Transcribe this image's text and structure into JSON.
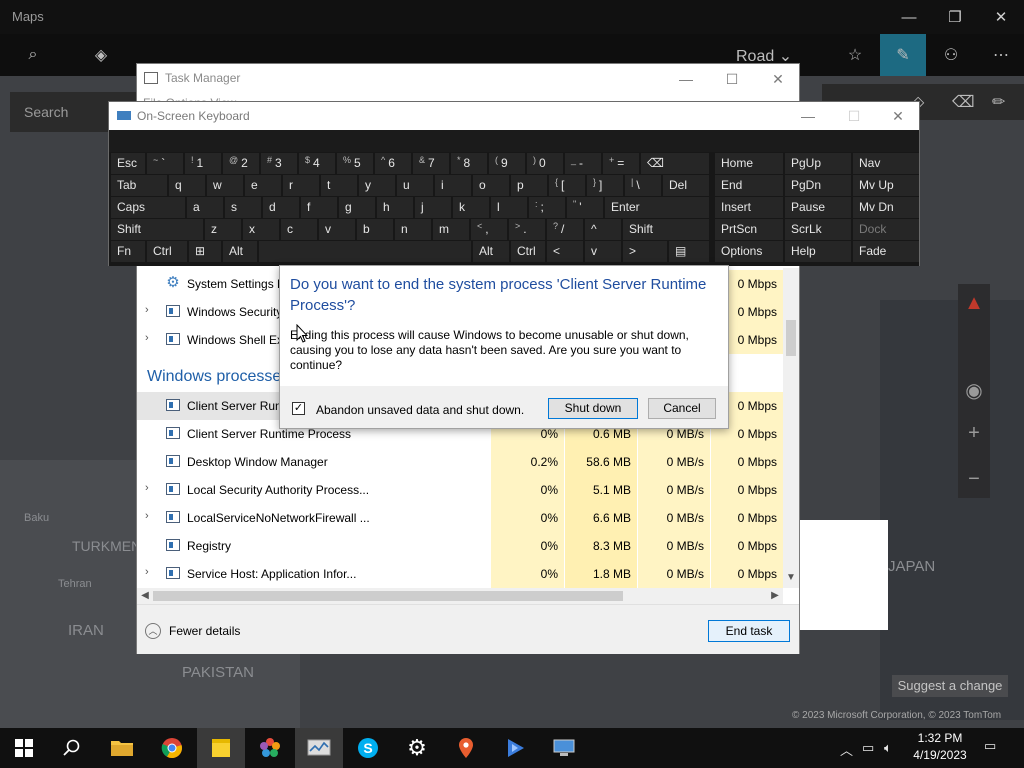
{
  "maps": {
    "title": "Maps",
    "search_placeholder": "Search",
    "road_label": "Road",
    "suggest_change": "Suggest a change",
    "copyright": "© 2023 Microsoft Corporation, © 2023 TomTom",
    "labels": {
      "baku": "Baku",
      "turkmen": "TURKMEN",
      "tehran": "Tehran",
      "iran": "IRAN",
      "pakistan": "PAKISTAN",
      "japan": "JAPAN"
    }
  },
  "task_manager": {
    "title": "Task Manager",
    "menu": "File  Options  View",
    "rows": [
      {
        "name": "System Settings B",
        "cpu": "",
        "mem": "",
        "disk": "",
        "net": "0 Mbps",
        "icon": "gear",
        "expand": false
      },
      {
        "name": "Windows Security",
        "cpu": "",
        "mem": "",
        "disk": "",
        "net": "0 Mbps",
        "icon": "window",
        "expand": true
      },
      {
        "name": "Windows Shell Ex",
        "cpu": "",
        "mem": "",
        "disk": "",
        "net": "0 Mbps",
        "icon": "window",
        "expand": true
      }
    ],
    "group_header": "Windows processes",
    "rows2": [
      {
        "name": "Client Server Runt",
        "cpu": "",
        "mem": "",
        "disk": "",
        "net": "0 Mbps",
        "expand": false
      },
      {
        "name": "Client Server Runtime Process",
        "cpu": "0%",
        "mem": "0.6 MB",
        "disk": "0 MB/s",
        "net": "0 Mbps",
        "expand": false
      },
      {
        "name": "Desktop Window Manager",
        "cpu": "0.2%",
        "mem": "58.6 MB",
        "disk": "0 MB/s",
        "net": "0 Mbps",
        "expand": false
      },
      {
        "name": "Local Security Authority Process...",
        "cpu": "0%",
        "mem": "5.1 MB",
        "disk": "0 MB/s",
        "net": "0 Mbps",
        "expand": true
      },
      {
        "name": "LocalServiceNoNetworkFirewall ...",
        "cpu": "0%",
        "mem": "6.6 MB",
        "disk": "0 MB/s",
        "net": "0 Mbps",
        "expand": true
      },
      {
        "name": "Registry",
        "cpu": "0%",
        "mem": "8.3 MB",
        "disk": "0 MB/s",
        "net": "0 Mbps",
        "expand": false
      },
      {
        "name": "Service Host: Application Infor...",
        "cpu": "0%",
        "mem": "1.8 MB",
        "disk": "0 MB/s",
        "net": "0 Mbps",
        "expand": true
      }
    ],
    "fewer_details": "Fewer details",
    "end_task": "End task"
  },
  "osk": {
    "title": "On-Screen Keyboard",
    "row1": [
      {
        "label": "Esc"
      },
      {
        "sub": "~",
        "label": "`"
      },
      {
        "sub": "!",
        "label": "1"
      },
      {
        "sub": "@",
        "label": "2"
      },
      {
        "sub": "#",
        "label": "3"
      },
      {
        "sub": "$",
        "label": "4"
      },
      {
        "sub": "%",
        "label": "5"
      },
      {
        "sub": "^",
        "label": "6"
      },
      {
        "sub": "&",
        "label": "7"
      },
      {
        "sub": "*",
        "label": "8"
      },
      {
        "sub": "(",
        "label": "9"
      },
      {
        "sub": ")",
        "label": "0"
      },
      {
        "sub": "_",
        "label": "-"
      },
      {
        "sub": "+",
        "label": "="
      },
      {
        "label": "⌫"
      }
    ],
    "row2": [
      {
        "label": "Tab"
      },
      {
        "label": "q"
      },
      {
        "label": "w"
      },
      {
        "label": "e"
      },
      {
        "label": "r"
      },
      {
        "label": "t"
      },
      {
        "label": "y"
      },
      {
        "label": "u"
      },
      {
        "label": "i"
      },
      {
        "label": "o"
      },
      {
        "label": "p"
      },
      {
        "sub": "{",
        "label": "["
      },
      {
        "sub": "}",
        "label": "]"
      },
      {
        "sub": "|",
        "label": "\\"
      },
      {
        "label": "Del"
      }
    ],
    "row3": [
      {
        "label": "Caps"
      },
      {
        "label": "a"
      },
      {
        "label": "s"
      },
      {
        "label": "d"
      },
      {
        "label": "f"
      },
      {
        "label": "g"
      },
      {
        "label": "h"
      },
      {
        "label": "j"
      },
      {
        "label": "k"
      },
      {
        "label": "l"
      },
      {
        "sub": ":",
        "label": ";"
      },
      {
        "sub": "\"",
        "label": "'"
      },
      {
        "label": "Enter"
      }
    ],
    "row4": [
      {
        "label": "Shift"
      },
      {
        "label": "z"
      },
      {
        "label": "x"
      },
      {
        "label": "c"
      },
      {
        "label": "v"
      },
      {
        "label": "b"
      },
      {
        "label": "n"
      },
      {
        "label": "m"
      },
      {
        "sub": "<",
        "label": ","
      },
      {
        "sub": ">",
        "label": "."
      },
      {
        "sub": "?",
        "label": "/"
      },
      {
        "label": "^"
      },
      {
        "label": "Shift"
      }
    ],
    "row5": [
      {
        "label": "Fn"
      },
      {
        "label": "Ctrl"
      },
      {
        "label": "⊞"
      },
      {
        "label": "Alt"
      },
      {
        "label": ""
      },
      {
        "label": "Alt"
      },
      {
        "label": "Ctrl"
      },
      {
        "label": "<"
      },
      {
        "label": "v"
      },
      {
        "label": ">"
      },
      {
        "label": "▤"
      }
    ],
    "nav": [
      [
        "Home",
        "PgUp",
        "Nav"
      ],
      [
        "End",
        "PgDn",
        "Mv Up"
      ],
      [
        "Insert",
        "Pause",
        "Mv Dn"
      ],
      [
        "PrtScn",
        "ScrLk",
        "Dock"
      ],
      [
        "Options",
        "Help",
        "Fade"
      ]
    ]
  },
  "dialog": {
    "heading": "Do you want to end the system process 'Client Server Runtime Process'?",
    "body": "Ending this process will cause Windows to become unusable or shut down, causing you to lose any data hasn't been saved. Are you sure you want to continue?",
    "checkbox_label": "Abandon unsaved data and shut down.",
    "checkbox_checked": "✓",
    "shutdown": "Shut down",
    "cancel": "Cancel"
  },
  "taskbar": {
    "time": "1:32 PM",
    "date": "4/19/2023"
  },
  "colors": {
    "accent": "#0078d7",
    "dialog_heading": "#1f4d9f",
    "cpu_heat": "#fff4c4",
    "mem_heat": "#fff0b2",
    "taskbar": "#101010",
    "osk_key": "#262626"
  }
}
